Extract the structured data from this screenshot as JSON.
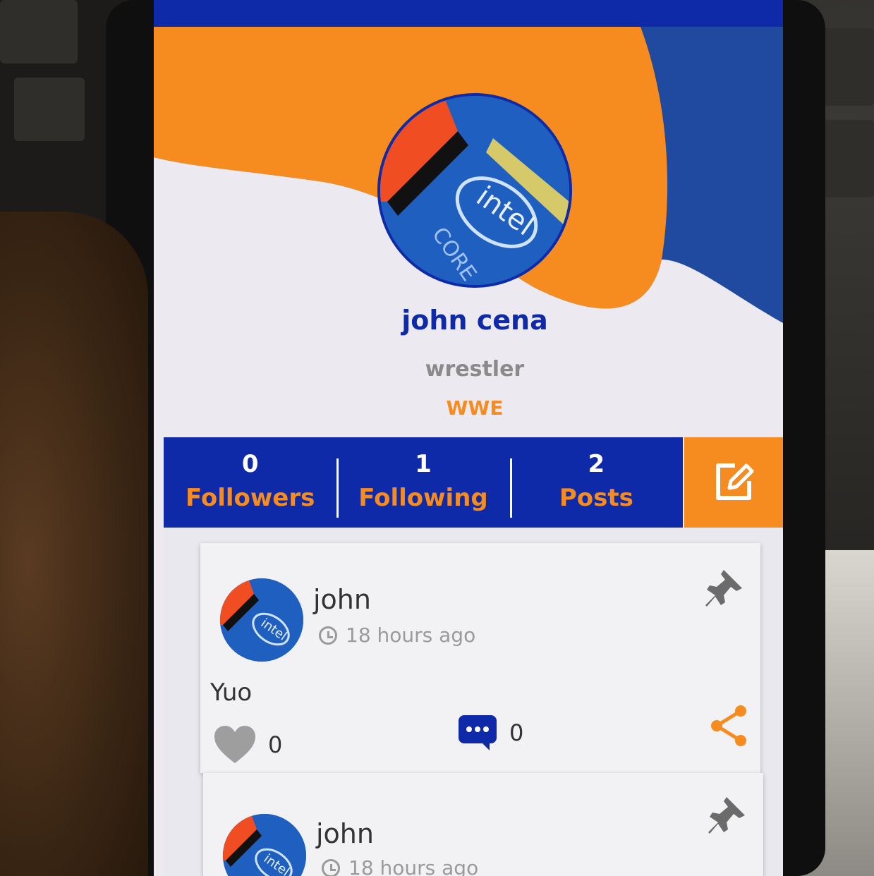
{
  "profile": {
    "name": "john cena",
    "title": "wrestler",
    "organization": "WWE"
  },
  "stats": [
    {
      "count": "0",
      "label": "Followers"
    },
    {
      "count": "1",
      "label": "Following"
    },
    {
      "count": "2",
      "label": "Posts"
    }
  ],
  "edit_icon": "edit-icon",
  "posts": [
    {
      "author": "john",
      "time": "18 hours ago",
      "text": "Yuo",
      "likes": "0",
      "comments": "0"
    },
    {
      "author": "john",
      "time": "18 hours ago"
    }
  ],
  "colors": {
    "primary_blue": "#0e2aa8",
    "accent_orange": "#f68b1f",
    "muted_gray": "#8a8a8a"
  }
}
